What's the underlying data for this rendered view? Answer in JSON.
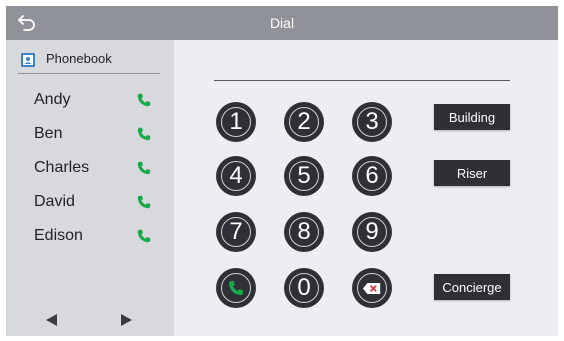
{
  "header": {
    "title": "Dial"
  },
  "sidebar": {
    "phonebook_label": "Phonebook",
    "contacts": [
      {
        "name": "Andy"
      },
      {
        "name": "Ben"
      },
      {
        "name": "Charles"
      },
      {
        "name": "David"
      },
      {
        "name": "Edison"
      }
    ]
  },
  "dialpad": {
    "number": "",
    "keys": [
      "1",
      "2",
      "3",
      "4",
      "5",
      "6",
      "7",
      "8",
      "9",
      "0"
    ]
  },
  "actions": {
    "building_label": "Building",
    "riser_label": "Riser",
    "concierge_label": "Concierge"
  },
  "colors": {
    "titlebar": "#8f9298",
    "sidebar": "#d7d9dd",
    "background": "#eceef2",
    "key": "#2e3036",
    "call_green": "#19a84a",
    "delete_red": "#d23a3a"
  }
}
